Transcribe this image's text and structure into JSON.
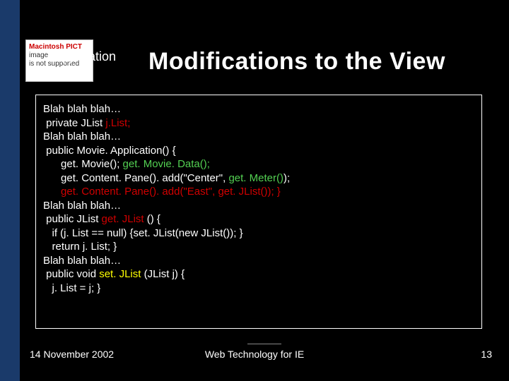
{
  "pict": {
    "line1": "Macintosh PICT",
    "line2": "image",
    "line3": "is not supported"
  },
  "header": {
    "app_label": "Application",
    "title": "Modifications to the View"
  },
  "code": {
    "l1_a": "Blah blah blah…",
    "l2_a": " private JList ",
    "l2_b": "j.List;",
    "l3_a": "Blah blah blah…",
    "l4_a": " public Movie. Application() {",
    "l5_a": "      get. Movie(); ",
    "l5_b": "get. Movie. Data();",
    "l6_a": "      get. Content. Pane(). add(\"Center\", ",
    "l6_b": "get. Meter()",
    "l6_c": ");",
    "l7_a": "      ",
    "l7_b": "get. Content. Pane(). add(\"East\", get. JList()); }",
    "l8_a": "Blah blah blah…",
    "l9_a": " public JList ",
    "l9_b": "get. JList",
    "l9_c": " () {",
    "l10_a": "   if (j. List == null) {set. JList(new JList()); }",
    "l11_a": "   return j. List; }",
    "l12_a": "Blah blah blah…",
    "l13_a": " public void ",
    "l13_b": "set. JList",
    "l13_c": " (JList j) {",
    "l14_a": "   j. List = j; }"
  },
  "footer": {
    "date": "14 November 2002",
    "center": "Web Technology for IE",
    "page": "13"
  }
}
